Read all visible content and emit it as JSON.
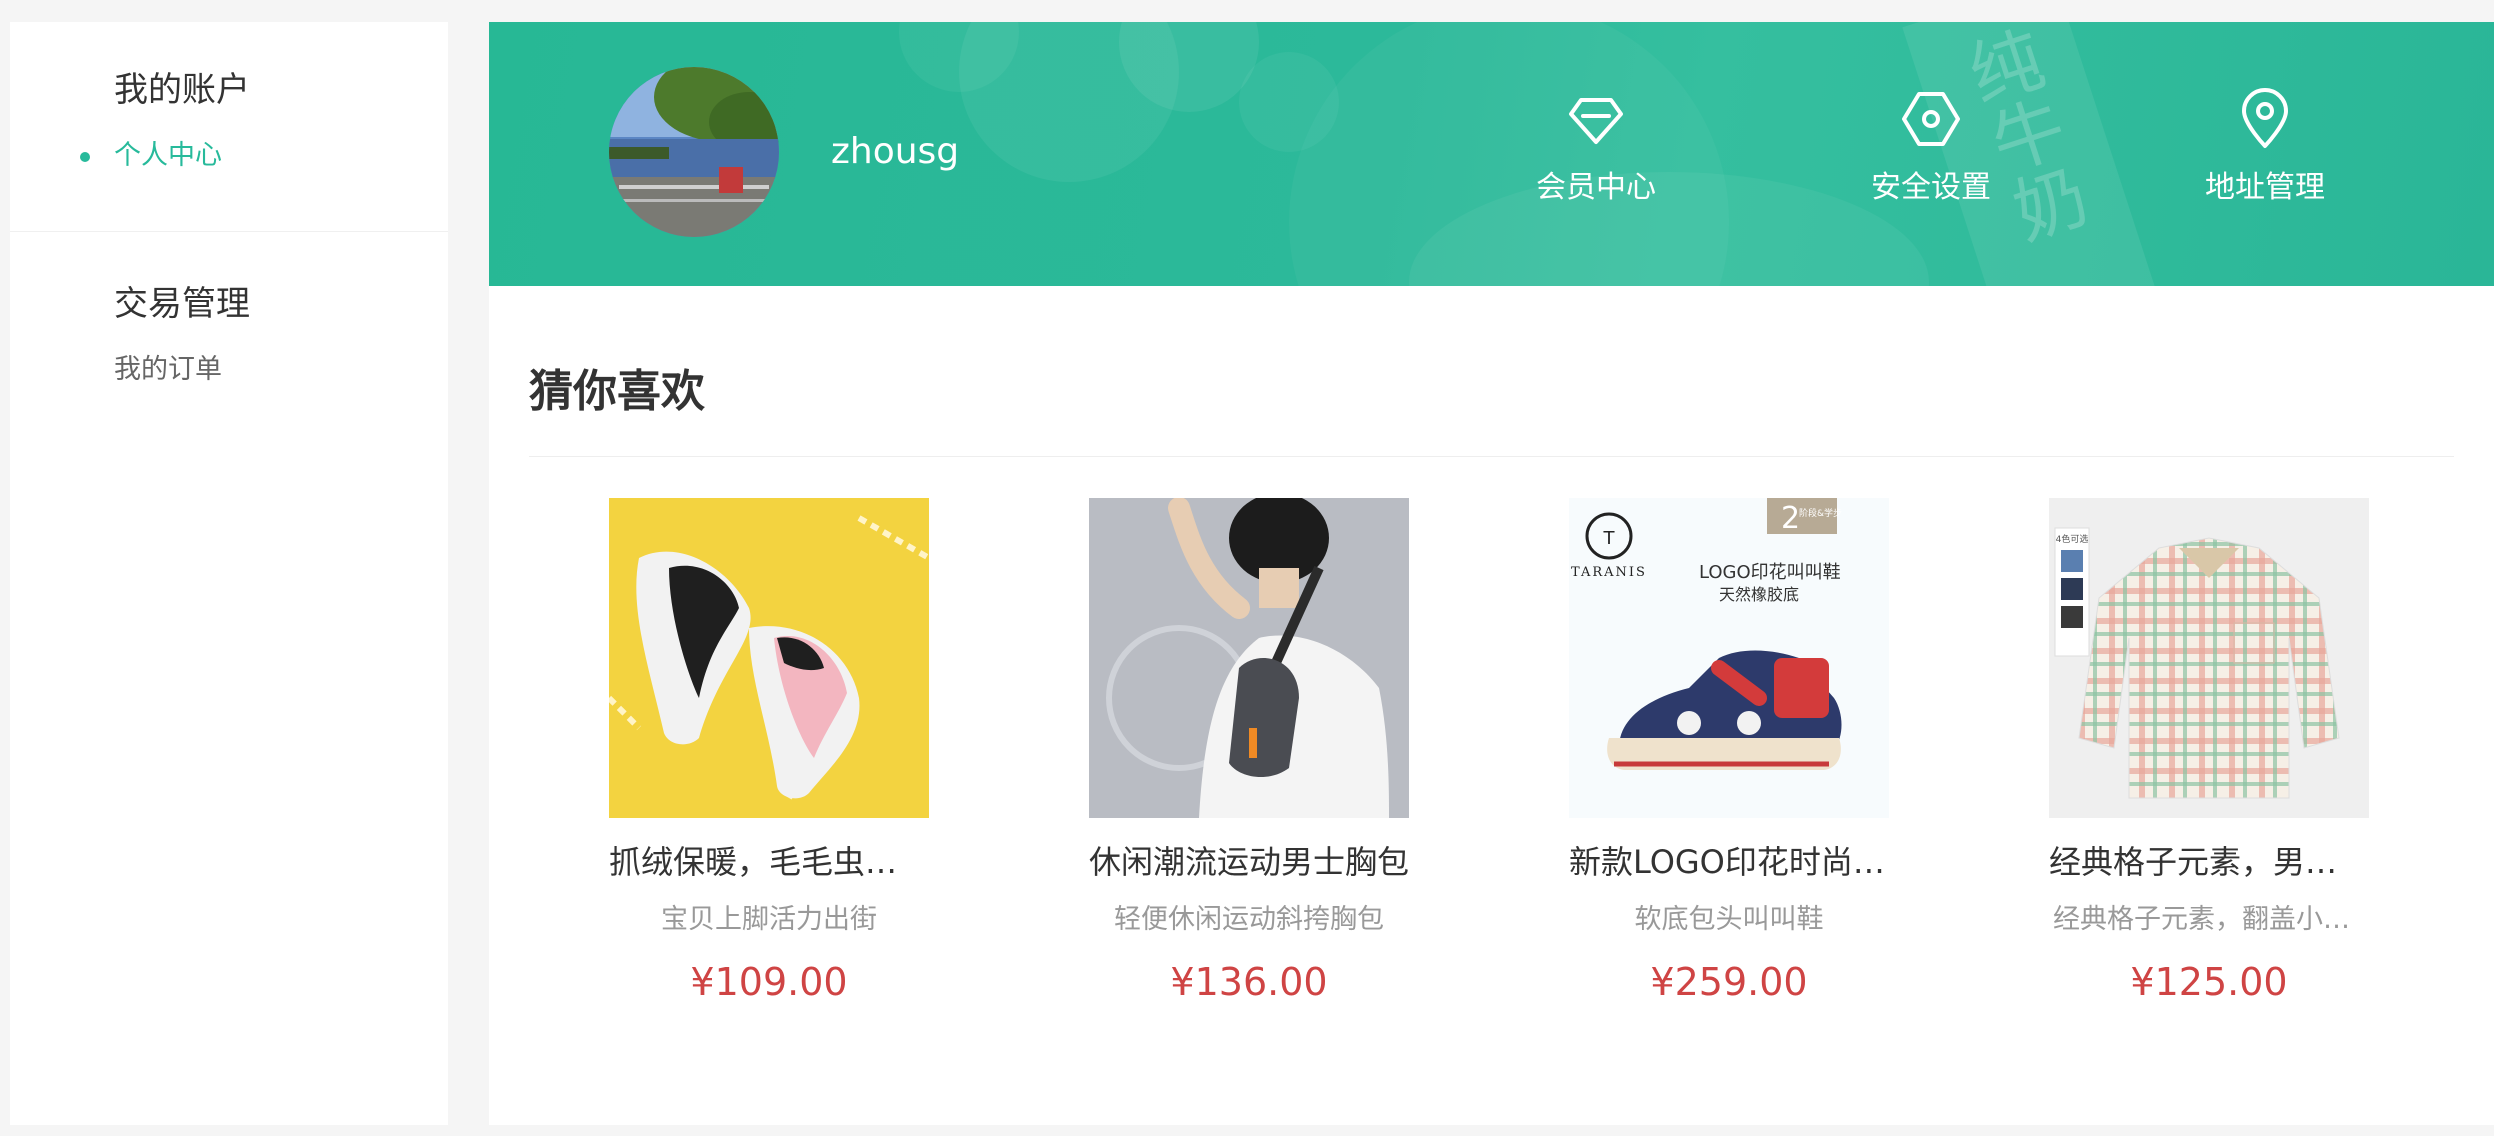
{
  "sidebar": {
    "groups": [
      {
        "title": "我的账户",
        "items": [
          {
            "label": "个人中心",
            "active": true
          }
        ]
      },
      {
        "title": "交易管理",
        "items": [
          {
            "label": "我的订单",
            "active": false
          }
        ]
      }
    ]
  },
  "profile": {
    "username": "zhousg",
    "banner_watermark": "纯牛奶"
  },
  "quick_links": [
    {
      "label": "会员中心",
      "icon": "diamond-icon"
    },
    {
      "label": "安全设置",
      "icon": "shield-hex-icon"
    },
    {
      "label": "地址管理",
      "icon": "location-pin-icon"
    }
  ],
  "recommend": {
    "title": "猜你喜欢",
    "goods": [
      {
        "name": "抓绒保暖，毛毛虫儿童运动鞋",
        "desc": "宝贝上脚活力出街",
        "price": "¥109.00"
      },
      {
        "name": "休闲潮流运动男士胸包",
        "desc": "轻便休闲运动斜挎胸包",
        "price": "¥136.00"
      },
      {
        "name": "新款LOGO印花时尚童鞋",
        "desc": "软底包头叫叫鞋",
        "price": "¥259.00"
      },
      {
        "name": "经典格子元素，男童衬衫",
        "desc": "经典格子元素，翻盖小口袋",
        "price": "¥125.00"
      }
    ],
    "shoe_ad": {
      "brand": "TARANIS",
      "badge": "2",
      "badge_note": "阶段&学步",
      "quote_line1": "LOGO印花叫叫鞋",
      "quote_line2": "天然橡胶底"
    },
    "shirt_ad": {
      "tag": "4色可选"
    }
  },
  "colors": {
    "accent": "#27ba9b",
    "price": "#cf4444",
    "muted": "#999999"
  }
}
